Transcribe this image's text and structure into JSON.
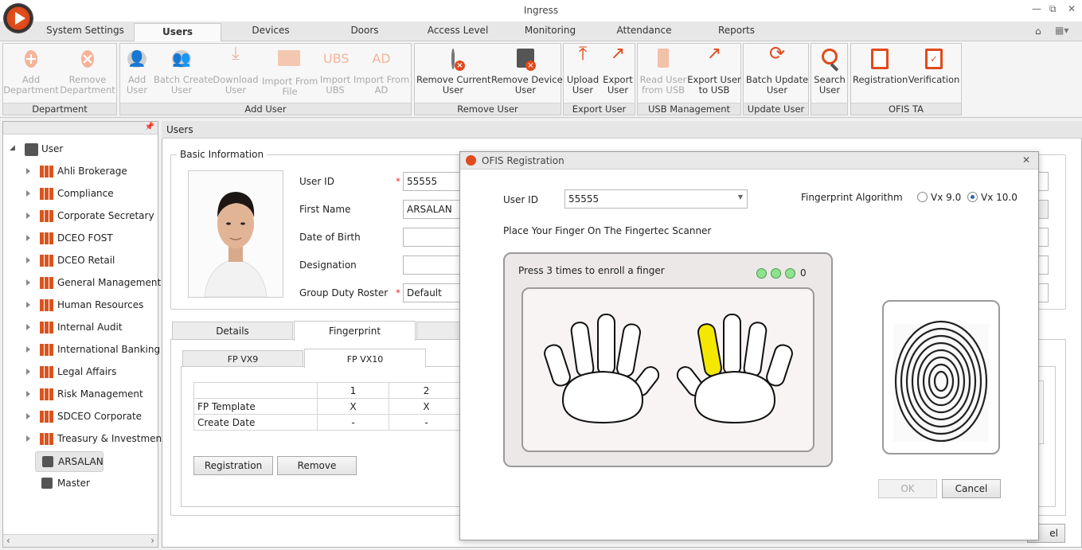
{
  "window": {
    "title": "Ingress",
    "minimize": "—",
    "restore": "⧉",
    "close": "✕"
  },
  "menu_tabs": [
    "System Settings",
    "Users",
    "Devices",
    "Doors",
    "Access Level",
    "Monitoring",
    "Attendance",
    "Reports"
  ],
  "active_tab": "Users",
  "ribbon": {
    "department": {
      "label": "Department",
      "add": "Add\nDepartment",
      "remove": "Remove\nDepartment"
    },
    "add_user": {
      "label": "Add User",
      "add": "Add\nUser",
      "batch": "Batch Create\nUser",
      "download": "Download\nUser",
      "import_file": "Import From\nFile",
      "import_ubs": "Import\nUBS",
      "import_ad": "Import From\nAD",
      "ubs_glyph": "UBS",
      "ad_glyph": "AD"
    },
    "remove_user": {
      "label": "Remove User",
      "current": "Remove Current\nUser",
      "device": "Remove Device\nUser"
    },
    "export_user": {
      "label": "Export User",
      "upload": "Upload\nUser",
      "export": "Export\nUser"
    },
    "usb": {
      "label": "USB Management",
      "read": "Read User\nfrom USB",
      "export": "Export User\nto USB"
    },
    "update_user": {
      "label": "Update User",
      "batch": "Batch Update\nUser"
    },
    "search": {
      "label": "Search\nUser"
    },
    "ofis": {
      "label": "OFIS TA",
      "registration": "Registration",
      "verification": "Verification"
    }
  },
  "tree": {
    "root": "User",
    "departments": [
      "Ahli Brokerage",
      "Compliance",
      "Corporate Secretary",
      "DCEO FOST",
      "DCEO Retail",
      "General Management",
      "Human Resources",
      "Internal Audit",
      "International Banking",
      "Legal Affairs",
      "Risk Management",
      "SDCEO Corporate",
      "Treasury & Investments"
    ],
    "users": [
      "ARSALAN",
      "Master"
    ],
    "selected": "ARSALAN"
  },
  "users_panel": {
    "header": "Users",
    "basic_info": "Basic Information",
    "fields": {
      "user_id_label": "User ID",
      "user_id": "55555",
      "first_name_label": "First Name",
      "first_name": "ARSALAN",
      "dob_label": "Date of Birth",
      "dob": "",
      "designation_label": "Designation",
      "designation": "",
      "roster_label": "Group Duty Roster",
      "roster": "Default",
      "required": "*"
    },
    "tabs": [
      "Details",
      "Fingerprint"
    ],
    "active_tab": "Fingerprint",
    "fp_tabs": [
      "FP VX9",
      "FP VX10"
    ],
    "fp_active": "FP VX10",
    "fp_table": {
      "columns": [
        "",
        "1",
        "2"
      ],
      "rows": [
        [
          "FP Template",
          "X",
          "X"
        ],
        [
          "Create Date",
          "-",
          "-"
        ]
      ]
    },
    "registration_btn": "Registration",
    "remove_btn": "Remove",
    "cancel_partial": "el"
  },
  "dialog": {
    "title": "OFIS Registration",
    "user_id_label": "User ID",
    "user_id": "55555",
    "algo_label": "Fingerprint Algorithm",
    "algo_options": [
      "Vx 9.0",
      "Vx 10.0"
    ],
    "algo_selected": "Vx 10.0",
    "instruction": "Place Your Finger On The Fingertec Scanner",
    "enroll_text": "Press 3 times to enroll a finger",
    "enroll_count": "0",
    "highlight_color": "#f5e800",
    "ok": "OK",
    "cancel": "Cancel"
  }
}
